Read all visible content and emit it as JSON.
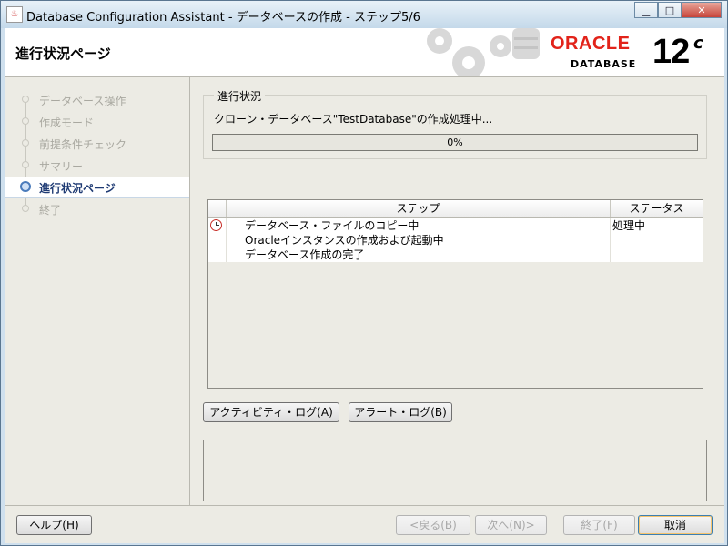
{
  "window": {
    "title": "Database Configuration Assistant - データベースの作成 - ステップ5/6",
    "icon": "java-cup-icon"
  },
  "header": {
    "page_title": "進行状況ページ",
    "brand": "ORACLE",
    "brand_sub": "DATABASE",
    "version": "12",
    "version_sup": "c"
  },
  "nav": {
    "items": [
      {
        "label": "データベース操作",
        "state": "done"
      },
      {
        "label": "作成モード",
        "state": "done"
      },
      {
        "label": "前提条件チェック",
        "state": "done"
      },
      {
        "label": "サマリー",
        "state": "done"
      },
      {
        "label": "進行状況ページ",
        "state": "active"
      },
      {
        "label": "終了",
        "state": "pending"
      }
    ]
  },
  "progress": {
    "group_title": "進行状況",
    "status": "クローン・データベース\"TestDatabase\"の作成処理中...",
    "percent_label": "0%",
    "percent": 0
  },
  "steps_table": {
    "columns": [
      "ステップ",
      "ステータス"
    ],
    "rows": [
      {
        "step": "データベース・ファイルのコピー中",
        "status": "処理中",
        "icon": "clock-icon"
      },
      {
        "step": "Oracleインスタンスの作成および起動中",
        "status": "",
        "icon": ""
      },
      {
        "step": "データベース作成の完了",
        "status": "",
        "icon": ""
      }
    ]
  },
  "buttons": {
    "activity_log": "アクティビティ・ログ(A)",
    "alert_log": "アラート・ログ(B)",
    "help": "ヘルプ(H)",
    "back": "<戻る(B)",
    "next": "次へ(N)>",
    "finish": "終了(F)",
    "cancel": "取消"
  },
  "colors": {
    "accent": "#4a7bbb",
    "oracle_red": "#e2231a",
    "active_nav_text": "#1e3a73"
  }
}
